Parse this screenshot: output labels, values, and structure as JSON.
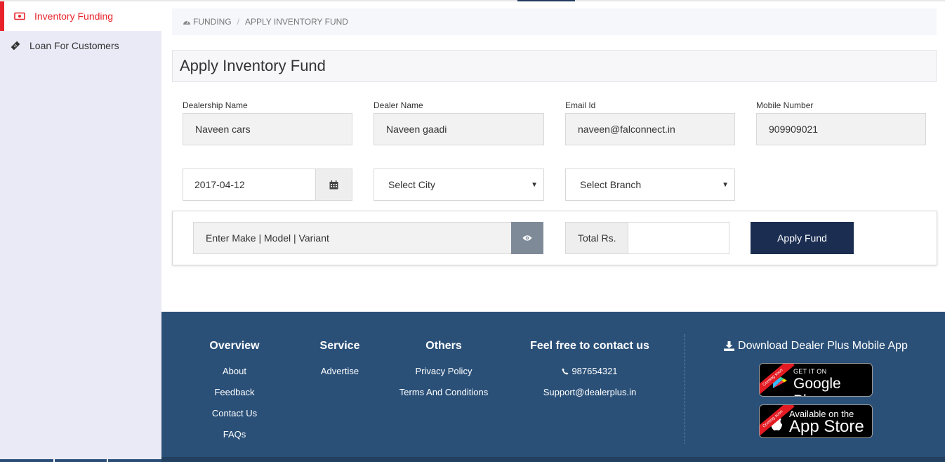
{
  "sidebar": {
    "items": [
      {
        "label": "Inventory Funding",
        "icon": "money-icon",
        "active": true
      },
      {
        "label": "Loan For Customers",
        "icon": "ticket-icon",
        "active": false
      }
    ]
  },
  "breadcrumb": {
    "root": "FUNDING",
    "current": "APPLY INVENTORY FUND"
  },
  "page": {
    "title": "Apply Inventory Fund"
  },
  "form": {
    "dealership_name": {
      "label": "Dealership Name",
      "value": "Naveen cars"
    },
    "dealer_name": {
      "label": "Dealer Name",
      "value": "Naveen gaadi"
    },
    "email": {
      "label": "Email Id",
      "value": "naveen@falconnect.in"
    },
    "mobile": {
      "label": "Mobile Number",
      "value": "909909021"
    },
    "date": "2017-04-12",
    "city_select": "Select City",
    "branch_select": "Select Branch"
  },
  "vehicle": {
    "placeholder": "Enter Make | Model | Variant",
    "total_label": "Total Rs.",
    "total_value": "",
    "apply_button": "Apply Fund"
  },
  "footer": {
    "overview": {
      "title": "Overview",
      "links": [
        "About",
        "Feedback",
        "Contact Us",
        "FAQs"
      ]
    },
    "service": {
      "title": "Service",
      "links": [
        "Advertise"
      ]
    },
    "others": {
      "title": "Others",
      "links": [
        "Privacy Policy",
        "Terms And Conditions"
      ]
    },
    "contact": {
      "title": "Feel free to contact us",
      "phone": "987654321",
      "email": "Support@dealerplus.in"
    },
    "download": {
      "title": "Download Dealer Plus Mobile App",
      "google": {
        "small": "GET IT ON",
        "big": "Google Play",
        "ribbon": "Coming soon"
      },
      "apple": {
        "small": "Available on the",
        "big": "App Store",
        "ribbon": "Coming soon"
      }
    }
  },
  "colors": {
    "accent_red": "#e8222a",
    "sidebar_bg": "#eaeaf7",
    "navy_button": "#1b2e52",
    "footer_bg": "#2a5078"
  }
}
